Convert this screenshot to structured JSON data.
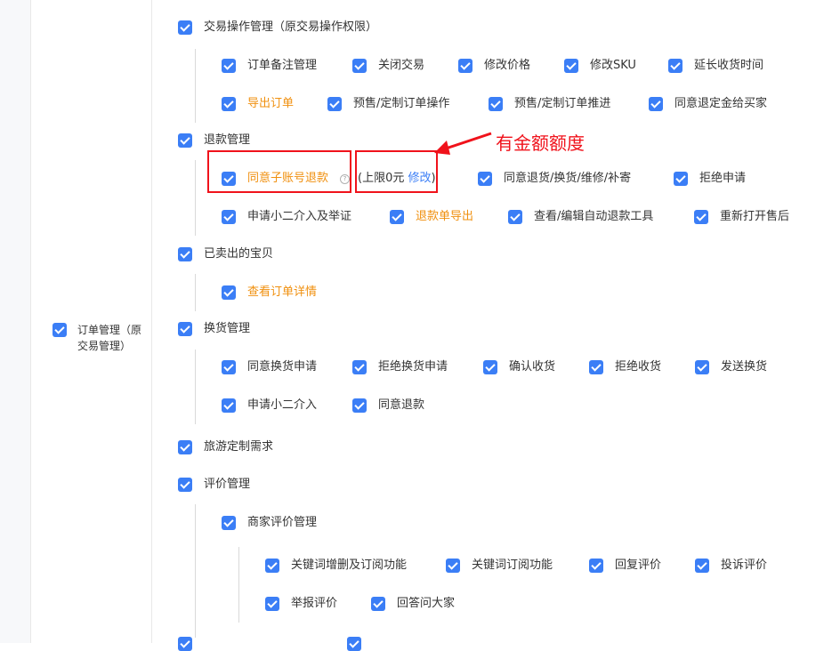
{
  "sidebar": {
    "order_mgmt_label": "订单管理（原交易管理）"
  },
  "sections": {
    "trade": {
      "title": "交易操作管理（原交易操作权限）",
      "items": [
        "订单备注管理",
        "关闭交易",
        "修改价格",
        "修改SKU",
        "延长收货时间",
        "导出订单",
        "预售/定制订单操作",
        "预售/定制订单推进",
        "同意退定金给买家"
      ]
    },
    "refund": {
      "title": "退款管理",
      "items": [
        "同意子账号退款",
        "同意退货/换货/维修/补寄",
        "拒绝申请",
        "申请小二介入及举证",
        "退款单导出",
        "查看/编辑自动退款工具",
        "重新打开售后"
      ],
      "limit_prefix": "(上限0元 ",
      "limit_edit": "修改",
      "limit_suffix": ")"
    },
    "sold": {
      "title": "已卖出的宝贝",
      "items": [
        "查看订单详情"
      ]
    },
    "exchange": {
      "title": "换货管理",
      "items": [
        "同意换货申请",
        "拒绝换货申请",
        "确认收货",
        "拒绝收货",
        "发送换货",
        "申请小二介入",
        "同意退款"
      ]
    },
    "travel": {
      "title": "旅游定制需求"
    },
    "review": {
      "title": "评价管理",
      "sub_title": "商家评价管理",
      "items": [
        "关键词增删及订阅功能",
        "关键词订阅功能",
        "回复评价",
        "投诉评价",
        "举报评价",
        "回答问大家"
      ]
    }
  },
  "annotation": {
    "text": "有金额额度"
  },
  "colors": {
    "checkbox": "#3b7ef6",
    "highlight_text": "#f0900f",
    "annotation": "#f0121b",
    "link": "#3b7ef6"
  },
  "icons": {
    "checkbox": "check-icon",
    "help": "question-circle-icon"
  }
}
